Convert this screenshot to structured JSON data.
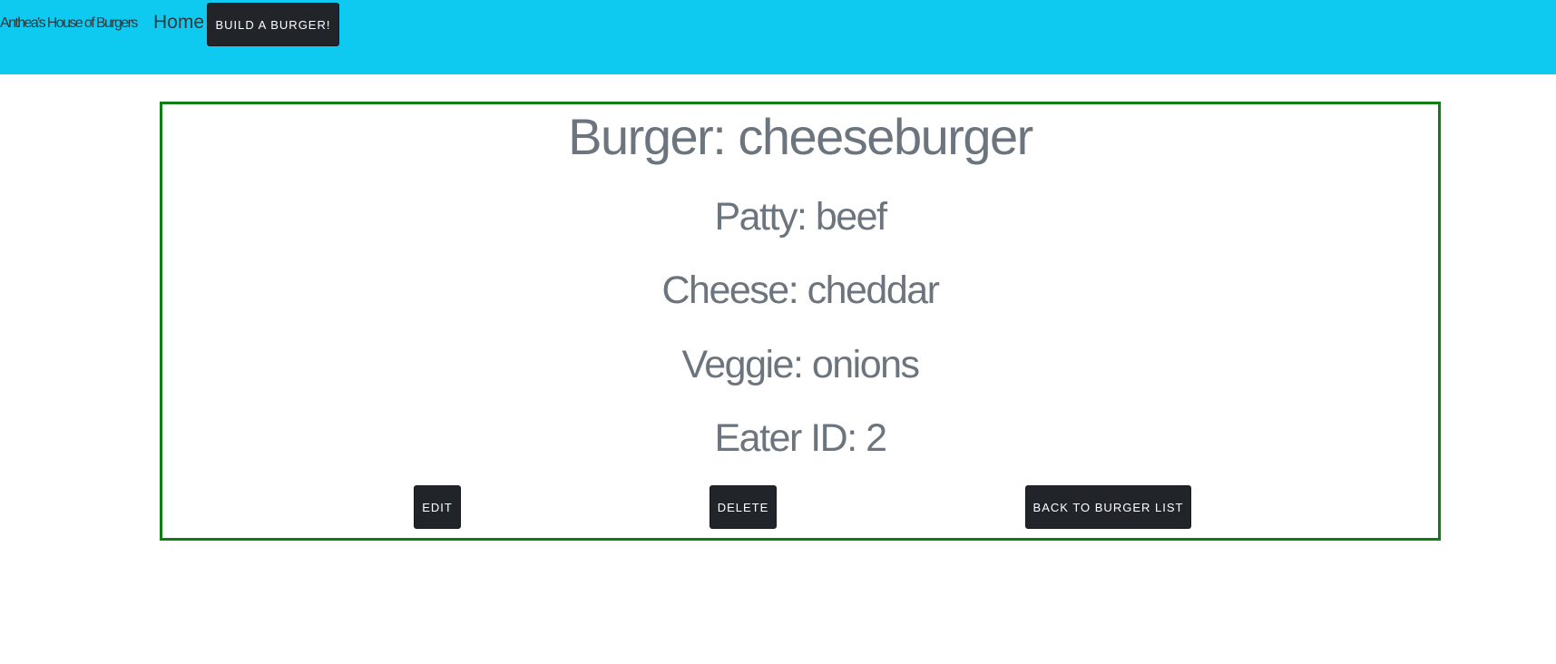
{
  "nav": {
    "brand": "Anthea's House of Burgers",
    "home_label": "Home",
    "build_label": "Build a Burger!"
  },
  "burger": {
    "title": "Burger: cheeseburger",
    "patty": "Patty: beef",
    "cheese": "Cheese: cheddar",
    "veggie": "Veggie: onions",
    "eater": "Eater ID: 2"
  },
  "actions": {
    "edit_label": "Edit",
    "delete_label": "Delete",
    "back_label": "Back to Burger List"
  },
  "colors": {
    "navbar": "#0ecaf0",
    "button": "#212529",
    "card_border": "#0d7d14",
    "text": "#6c757d"
  }
}
